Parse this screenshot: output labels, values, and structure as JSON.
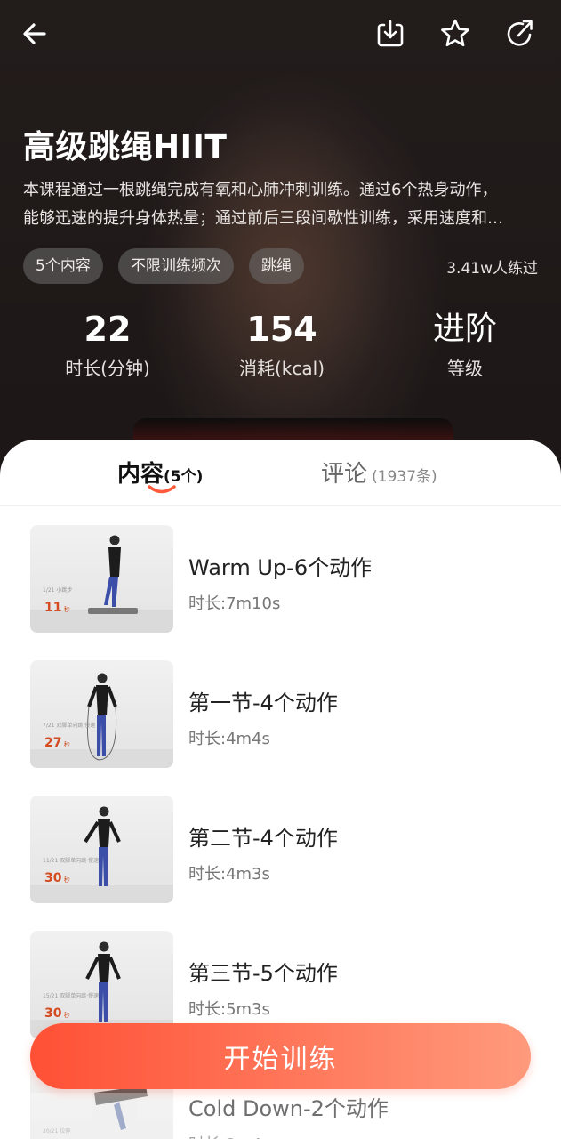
{
  "course": {
    "title": "高级跳绳HIIT",
    "description_line1": "本课程通过一根跳绳完成有氧和心肺冲刺训练。通过6个热身动作，",
    "description_line2": "能够迅速的提升身体热量；通过前后三段间歇性训练，采用速度和…",
    "tags": [
      "5个内容",
      "不限训练频次",
      "跳绳"
    ],
    "trained_count": "3.41w人练过"
  },
  "stats": [
    {
      "value": "22",
      "label": "时长(分钟)"
    },
    {
      "value": "154",
      "label": "消耗(kcal)"
    },
    {
      "value": "进阶",
      "label": "等级"
    }
  ],
  "tabs": [
    {
      "label": "内容",
      "sub": "(5个)",
      "active": true
    },
    {
      "label": "评论",
      "sub": "(1937条)",
      "active": false
    }
  ],
  "sections": [
    {
      "title": "Warm Up-6个动作",
      "duration": "时长:7m10s",
      "thumb_number": "11",
      "thumb_caption": "1/21 小跳步"
    },
    {
      "title": "第一节-4个动作",
      "duration": "时长:4m4s",
      "thumb_number": "27",
      "thumb_caption": "7/21 双脚单向跳·慢速"
    },
    {
      "title": "第二节-4个动作",
      "duration": "时长:4m3s",
      "thumb_number": "30",
      "thumb_caption": "11/21 双脚单向跳·慢速"
    },
    {
      "title": "第三节-5个动作",
      "duration": "时长:5m3s",
      "thumb_number": "30",
      "thumb_caption": "15/21 双脚单向跳·慢速"
    },
    {
      "title": "Cold Down-2个动作",
      "duration": "时长:2m4s",
      "thumb_number": "",
      "thumb_caption": "20/21 拉伸"
    }
  ],
  "start_button": "开始训练",
  "colors": {
    "accent": "#ff5a3c",
    "accent_end": "#ff9a7c",
    "thumb_number": "#d54a1e"
  },
  "icons": [
    "back-arrow-icon",
    "download-icon",
    "star-icon",
    "share-icon"
  ]
}
